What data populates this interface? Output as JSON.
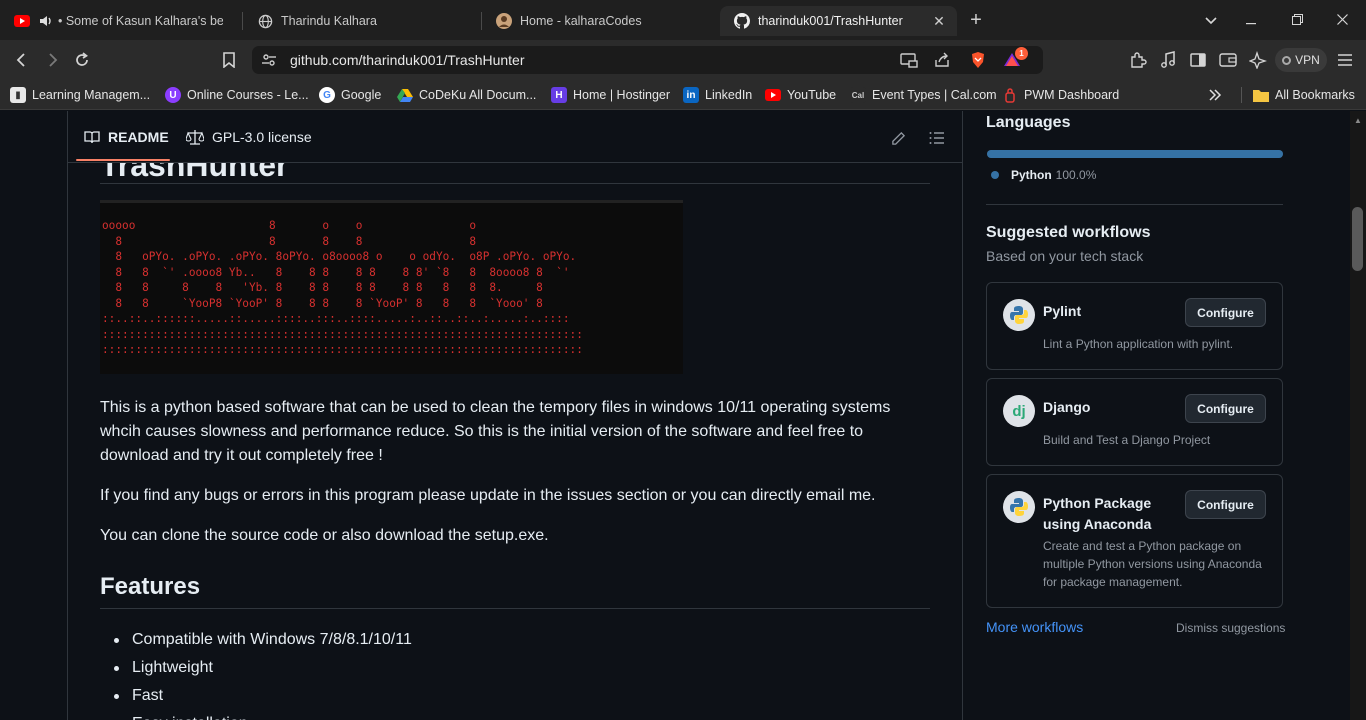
{
  "browser": {
    "tabs": [
      {
        "title": "• Some of Kasun Kalhara's best s",
        "icon": "youtube-icon"
      },
      {
        "title": "Tharindu Kalhara",
        "icon": "globe-icon"
      },
      {
        "title": "Home - kalharaCodes",
        "icon": "avatar-icon"
      },
      {
        "title": "tharinduk001/TrashHunter",
        "icon": "github-icon"
      }
    ],
    "url": "github.com/tharinduk001/TrashHunter",
    "brave_badge": "1",
    "vpn_label": "VPN",
    "bookmarks": [
      {
        "label": "Learning Managem...",
        "color": "#e8e8e8"
      },
      {
        "label": "Online Courses - Le...",
        "color": "#8b3dff"
      },
      {
        "label": "Google",
        "color": "#ffffff"
      },
      {
        "label": "CoDeKu All Docum...",
        "color": "#34a853"
      },
      {
        "label": "Home | Hostinger",
        "color": "#673de6"
      },
      {
        "label": "LinkedIn",
        "color": "#0a66c2"
      },
      {
        "label": "YouTube",
        "color": "#ff0000"
      },
      {
        "label": "Event Types | Cal.com",
        "color": "#2b2b2b"
      },
      {
        "label": "PWM Dashboard",
        "color": "#e53935"
      }
    ],
    "all_bookmarks": "All Bookmarks"
  },
  "readme": {
    "tabs": [
      {
        "label": "README",
        "icon": "book-icon"
      },
      {
        "label": "GPL-3.0 license",
        "icon": "scale-icon"
      }
    ],
    "title_cut": "TrashHunter",
    "ascii_art": "ooooo                    8       o    o                o\n  8                      8       8    8                8\n  8   oPYo. .oPYo. .oPYo. 8oPYo. o8oooo8 o    o odYo.  o8P .oPYo. oPYo.\n  8   8  `' .oooo8 Yb..   8    8 8    8 8    8 8' `8   8  8oooo8 8  `'\n  8   8     8    8   'Yb. 8    8 8    8 8    8 8   8   8  8.     8\n  8   8     `YooP8 `YooP' 8    8 8    8 `YooP' 8   8   8  `Yooo' 8\n::..::..::::::.....::.....::::..:::..::::.....:..::..::..:.....:..::::\n::::::::::::::::::::::::::::::::::::::::::::::::::::::::::::::::::::::::\n::::::::::::::::::::::::::::::::::::::::::::::::::::::::::::::::::::::::",
    "para1": "This is a python based software that can be used to clean the tempory files in windows 10/11 operating systems whcih causes slowness and performance reduce. So this is the initial version of the software and feel free to download and try it out completely free !",
    "para2": "If you find any bugs or errors in this program please update in the issues section or you can directly email me.",
    "para3": "You can clone the source code or also download the setup.exe.",
    "features_heading": "Features",
    "features": [
      "Compatible with Windows 7/8/8.1/10/11",
      "Lightweight",
      "Fast",
      "Easy installation"
    ]
  },
  "sidebar": {
    "languages_title": "Languages",
    "language": {
      "name": "Python",
      "percent": "100.0%",
      "share": 1.0,
      "color": "#3572a5"
    },
    "workflows_title": "Suggested workflows",
    "workflows_subtitle": "Based on your tech stack",
    "workflows": [
      {
        "name": "Pylint",
        "desc": "Lint a Python application with pylint.",
        "button": "Configure",
        "icon": "python-icon"
      },
      {
        "name": "Django",
        "desc": "Build and Test a Django Project",
        "button": "Configure",
        "icon": "django-icon"
      },
      {
        "name": "Python Package using Anaconda",
        "desc": "Create and test a Python package on multiple Python versions using Anaconda for package management.",
        "button": "Configure",
        "icon": "python-icon"
      }
    ],
    "more_workflows": "More workflows",
    "dismiss": "Dismiss suggestions"
  }
}
